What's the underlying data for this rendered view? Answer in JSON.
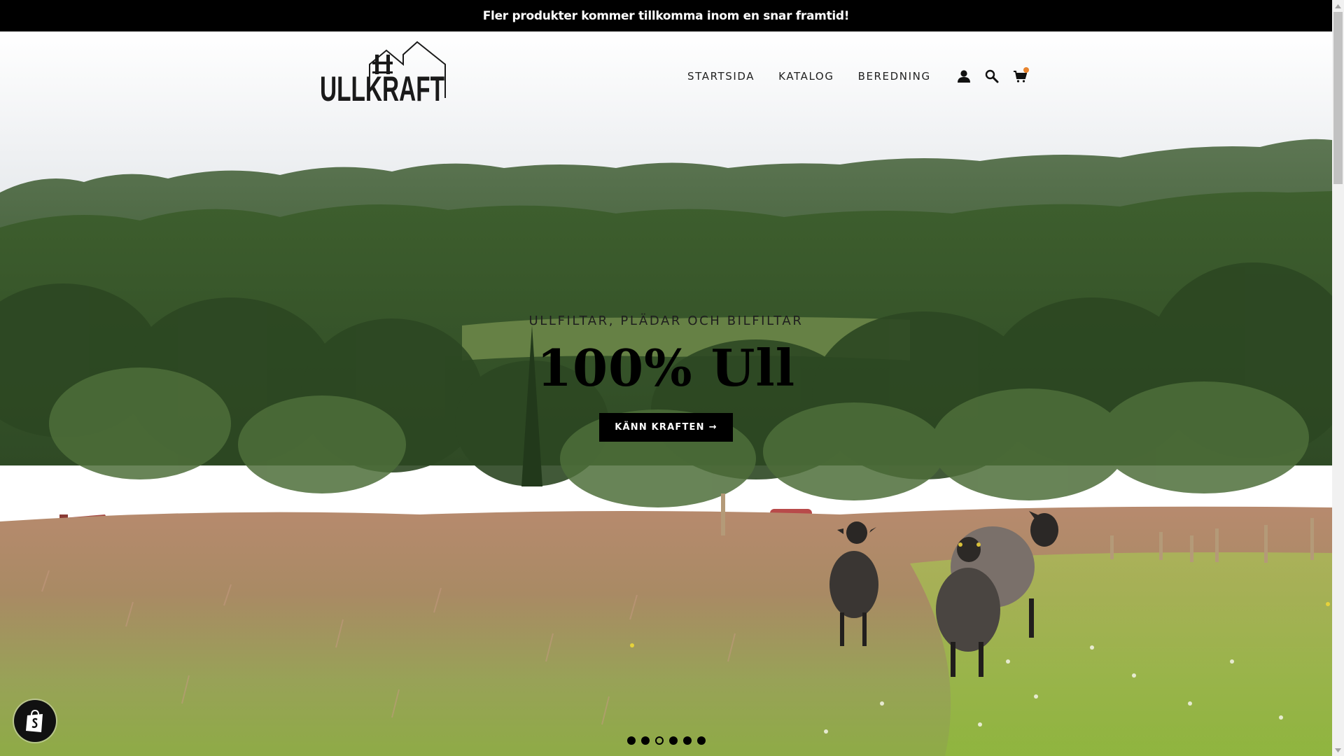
{
  "announcement": {
    "text": "Fler produkter kommer tillkomma inom en snar framtid!"
  },
  "header": {
    "logo_text": "ULLKRAFT",
    "nav": [
      {
        "label": "STARTSIDA"
      },
      {
        "label": "KATALOG"
      },
      {
        "label": "BEREDNING"
      }
    ],
    "icons": [
      "account-icon",
      "search-icon",
      "cart-icon"
    ],
    "cart_has_items": true
  },
  "hero": {
    "subtitle": "ULLFILTAR, PLÄDAR OCH BILFILTAR",
    "title": "100% Ull",
    "button_label": "KÄNN KRAFTEN",
    "button_arrow": "→"
  },
  "slideshow": {
    "total_slides": 6,
    "active_slide": 3
  },
  "colors": {
    "announcement_bg": "#000000",
    "announcement_text": "#ffffff",
    "button_bg": "#000000",
    "button_text": "#ffffff",
    "cart_dot": "#e8842e"
  }
}
